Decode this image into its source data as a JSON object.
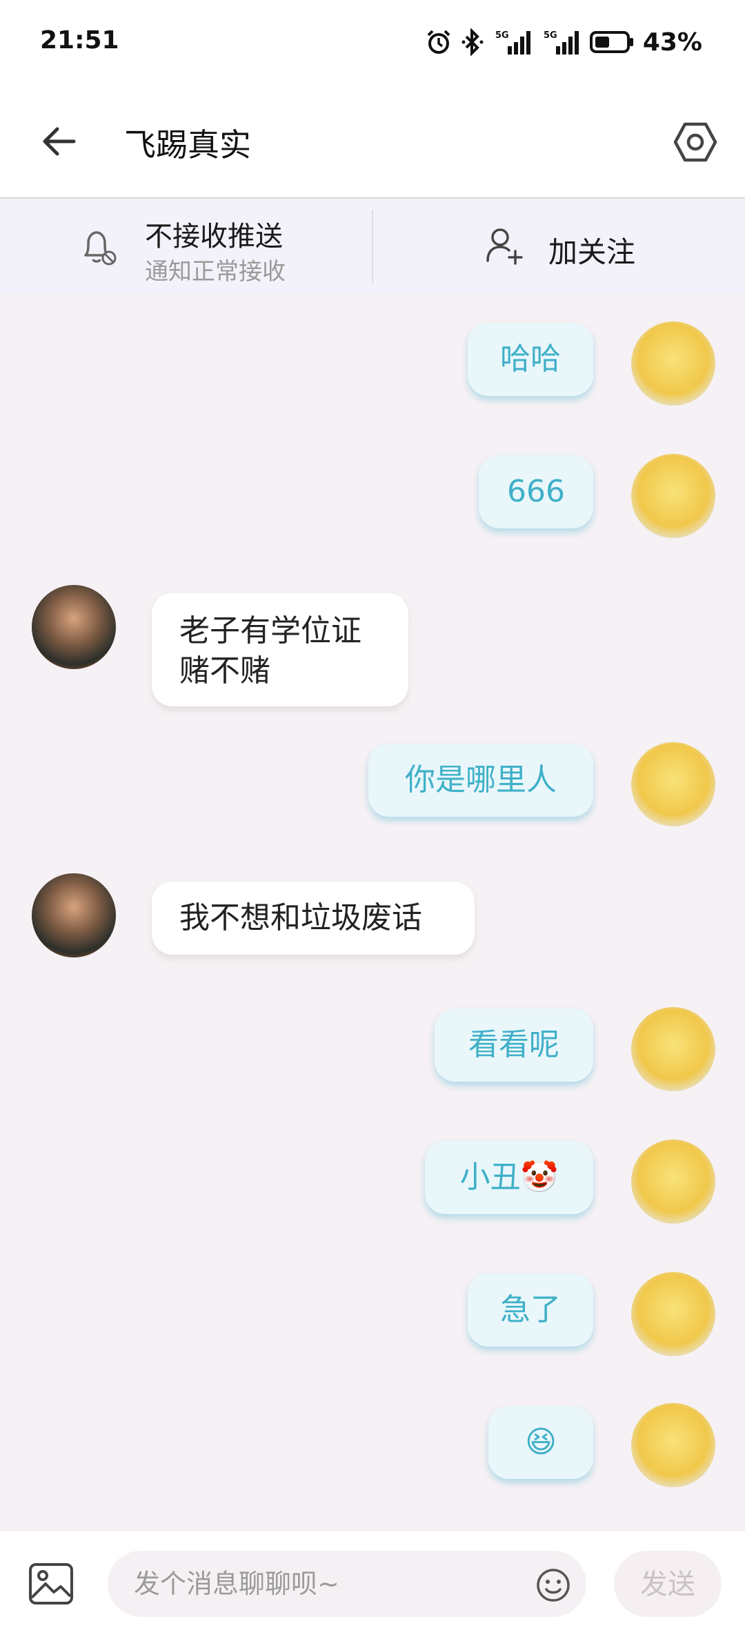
{
  "status_bar": {
    "time": "21:51",
    "battery": "43%",
    "icons": [
      "alarm-icon",
      "bluetooth-icon",
      "signal-5g-icon",
      "signal-5g-icon",
      "battery-icon"
    ]
  },
  "header": {
    "title": "飞踢真实",
    "back_icon": "arrow-left-icon",
    "settings_icon": "hexagon-settings-icon"
  },
  "actions": {
    "mute_title": "不接收推送",
    "mute_subtitle": "通知正常接收",
    "follow_label": "加关注"
  },
  "messages": [
    {
      "sender": "me",
      "text": "哈哈"
    },
    {
      "sender": "me",
      "text": "666"
    },
    {
      "sender": "other",
      "text": "老子有学位证\n赌不赌"
    },
    {
      "sender": "me",
      "text": "你是哪里人"
    },
    {
      "sender": "other",
      "text": "我不想和垃圾废话"
    },
    {
      "sender": "me",
      "text": "看看呢"
    },
    {
      "sender": "me",
      "text": "小丑🤡"
    },
    {
      "sender": "me",
      "text": "急了"
    },
    {
      "sender": "me",
      "text": "😆"
    }
  ],
  "input": {
    "placeholder": "发个消息聊聊呗~",
    "send_label": "发送"
  },
  "colors": {
    "my_bubble_bg": "#e9f7fb",
    "my_bubble_text": "#3fb0c8",
    "other_bubble_bg": "#ffffff",
    "chat_bg": "#f6f1f4"
  }
}
